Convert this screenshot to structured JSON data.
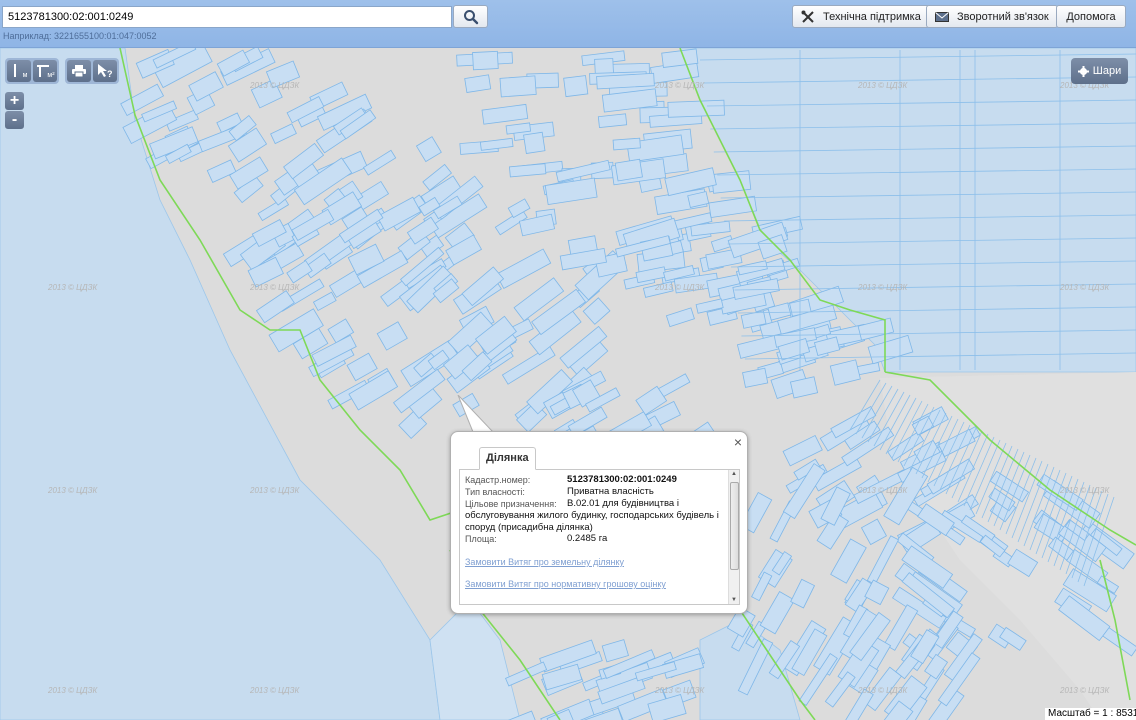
{
  "search": {
    "value": "5123781300:02:001:0249",
    "example": "Наприклад: 3221655100:01:047:0052"
  },
  "header_buttons": {
    "support": "Технічна підтримка",
    "feedback": "Зворотний зв'язок",
    "help": "Допомога"
  },
  "tools": {
    "ruler_label": "м",
    "area_label": "м²",
    "print_icon": "printer-icon",
    "info_icon": "pointer-question-icon"
  },
  "zoom": {
    "in": "+",
    "out": "-"
  },
  "layers_button": "Шари",
  "popup": {
    "tab": "Ділянка",
    "close": "×",
    "fields": [
      {
        "label": "Кадастр.номер:",
        "value": "5123781300:02:001:0249"
      },
      {
        "label": "Тип власності:",
        "value": "Приватна власність"
      },
      {
        "label": "Цільове призначення:",
        "value": "В.02.01 для будівництва і"
      },
      {
        "label": "Площа:",
        "value": "0.2485 га"
      }
    ],
    "purpose_continuation_1": "обслуговування жилого будинку, господарських будівель і",
    "purpose_continuation_2": "споруд (присадибна ділянка)",
    "links": [
      "Замовити Витяг про земельну ділянку",
      "Замовити Витяг про нормативну грошову оцінку"
    ]
  },
  "watermark": "2013 © ЦДЗК",
  "scale": "Масштаб = 1 : 8531",
  "colors": {
    "background": "#dcdcdc",
    "parcel_fill": "#c8def3",
    "parcel_stroke": "#7fb7e8",
    "boundary": "#7ed957",
    "header": "#9ec0ea",
    "link": "#7f9fd1"
  }
}
